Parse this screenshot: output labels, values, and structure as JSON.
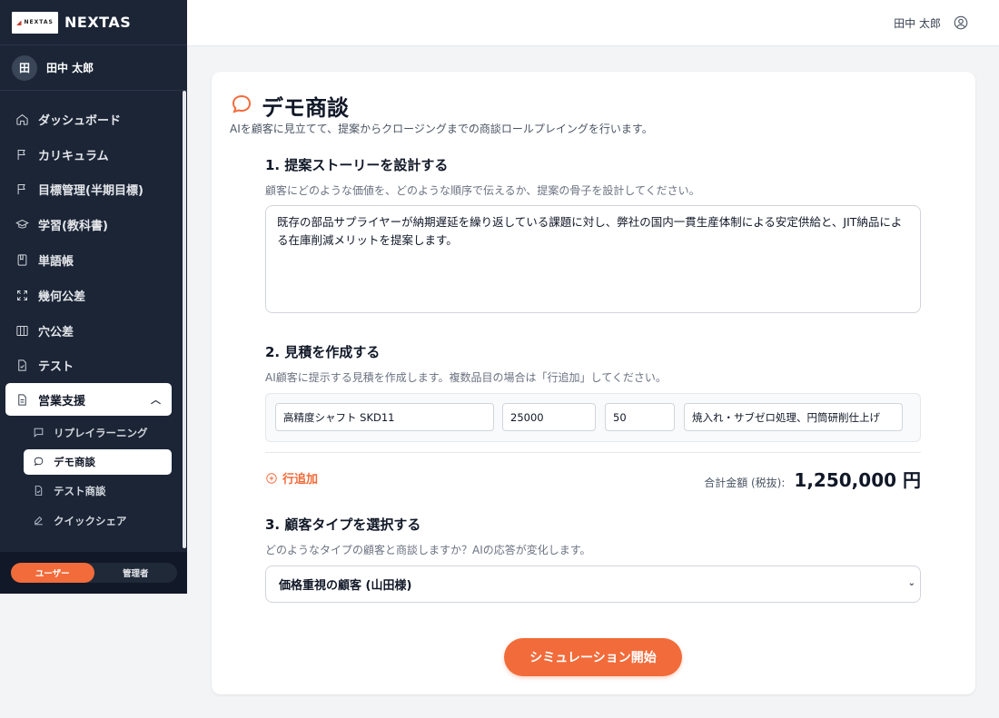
{
  "brand": {
    "logo_text": "NEXTAS",
    "name": "NEXTAS"
  },
  "user": {
    "avatar_initial": "田",
    "name": "田中 太郎"
  },
  "nav": {
    "items": [
      {
        "label": "ダッシュボード",
        "icon": "home-icon"
      },
      {
        "label": "カリキュラム",
        "icon": "flag-icon"
      },
      {
        "label": "目標管理(半期目標)",
        "icon": "flag-icon"
      },
      {
        "label": "学習(教科書)",
        "icon": "graduation-cap-icon"
      },
      {
        "label": "単語帳",
        "icon": "book-icon"
      },
      {
        "label": "幾何公差",
        "icon": "expand-icon"
      },
      {
        "label": "穴公差",
        "icon": "columns-icon"
      },
      {
        "label": "テスト",
        "icon": "file-check-icon"
      },
      {
        "label": "営業支援",
        "icon": "document-icon",
        "expanded": true
      }
    ],
    "sub_items": [
      {
        "label": "リプレイラーニング",
        "icon": "message-icon"
      },
      {
        "label": "デモ商談",
        "icon": "chat-bubble-icon",
        "active": true
      },
      {
        "label": "テスト商談",
        "icon": "file-check-icon"
      },
      {
        "label": "クイックシェア",
        "icon": "edit-icon"
      }
    ]
  },
  "role": {
    "user_label": "ユーザー",
    "admin_label": "管理者",
    "selected": "ユーザー"
  },
  "header": {
    "user_name": "田中 太郎"
  },
  "page": {
    "title": "デモ商談",
    "subtitle": "AIを顧客に見立てて、提案からクロージングまでの商談ロールプレイングを行います。"
  },
  "step1": {
    "heading": "1. 提案ストーリーを設計する",
    "description": "顧客にどのような価値を、どのような順序で伝えるか、提案の骨子を設計してください。",
    "value": "既存の部品サプライヤーが納期遅延を繰り返している課題に対し、弊社の国内一貫生産体制による安定供給と、JIT納品による在庫削減メリットを提案します。"
  },
  "step2": {
    "heading": "2. 見積を作成する",
    "description": "AI顧客に提示する見積を作成します。複数品目の場合は「行追加」してください。",
    "rows": [
      {
        "product": "高精度シャフト SKD11",
        "unit_price": "25000",
        "quantity": "50",
        "note": "焼入れ・サブゼロ処理、円筒研削仕上げ"
      }
    ],
    "add_row_label": "行追加",
    "total_label": "合計金額 (税抜):",
    "total_value": "1,250,000 円"
  },
  "step3": {
    "heading": "3. 顧客タイプを選択する",
    "description": "どのようなタイプの顧客と商談しますか？AIの応答が変化します。",
    "selected": "価格重視の顧客 (山田様)"
  },
  "start_button": "シミュレーション開始",
  "colors": {
    "accent": "#f26b3a",
    "sidebar_bg": "#1b2536"
  }
}
